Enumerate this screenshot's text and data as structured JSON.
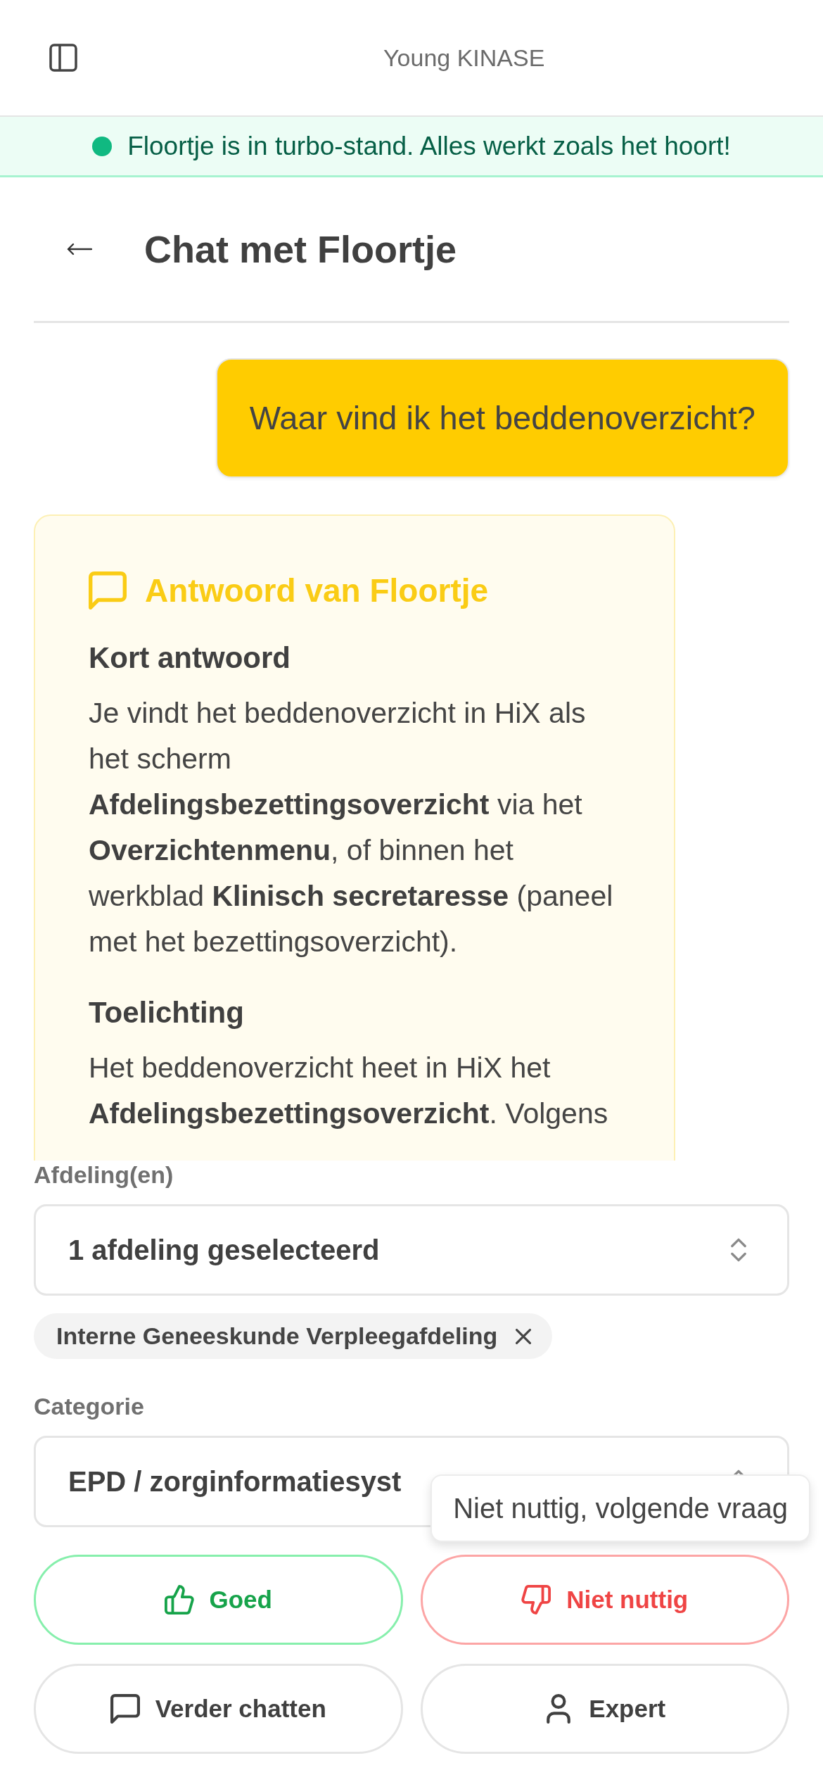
{
  "header": {
    "title": "Young KINASE"
  },
  "status_banner": {
    "kind": "success",
    "text": "Floortje is in turbo-stand. Alles werkt zoals het hoort!"
  },
  "chat": {
    "title": "Chat met Floortje",
    "messages": [
      {
        "kind": "user",
        "text": "Waar vind ik het beddenoverzicht?"
      },
      {
        "kind": "answer",
        "title": "Antwoord van Floortje",
        "sections": [
          {
            "heading": "Kort antwoord",
            "text": "Je vindt het beddenoverzicht in HiX als het scherm **Afdelingsbezettingsoverzicht** via het **Overzichtenmenu**, of binnen het werkblad **Klinisch secretaresse** (paneel met het bezettingsoverzicht)."
          },
          {
            "heading": "Toelichting",
            "text": "Het beddenoverzicht heet in HiX het **Afdelingsbezettingsoverzicht**. Volgens"
          }
        ]
      }
    ]
  },
  "form": {
    "fields": [
      {
        "label": "Afdeling(en)",
        "value": "1 afdeling geselecteerd",
        "chips": [
          "Interne Geneeskunde Verpleegafdeling"
        ]
      },
      {
        "label": "Categorie",
        "value": "EPD / zorginformatiesyst"
      }
    ]
  },
  "tooltip": "Niet nuttig, volgende vraag",
  "actions": [
    {
      "kind": "good",
      "label": "Goed"
    },
    {
      "kind": "bad",
      "label": "Niet nuttig"
    },
    {
      "kind": "chat",
      "label": "Verder chatten"
    },
    {
      "kind": "expert",
      "label": "Expert"
    }
  ]
}
